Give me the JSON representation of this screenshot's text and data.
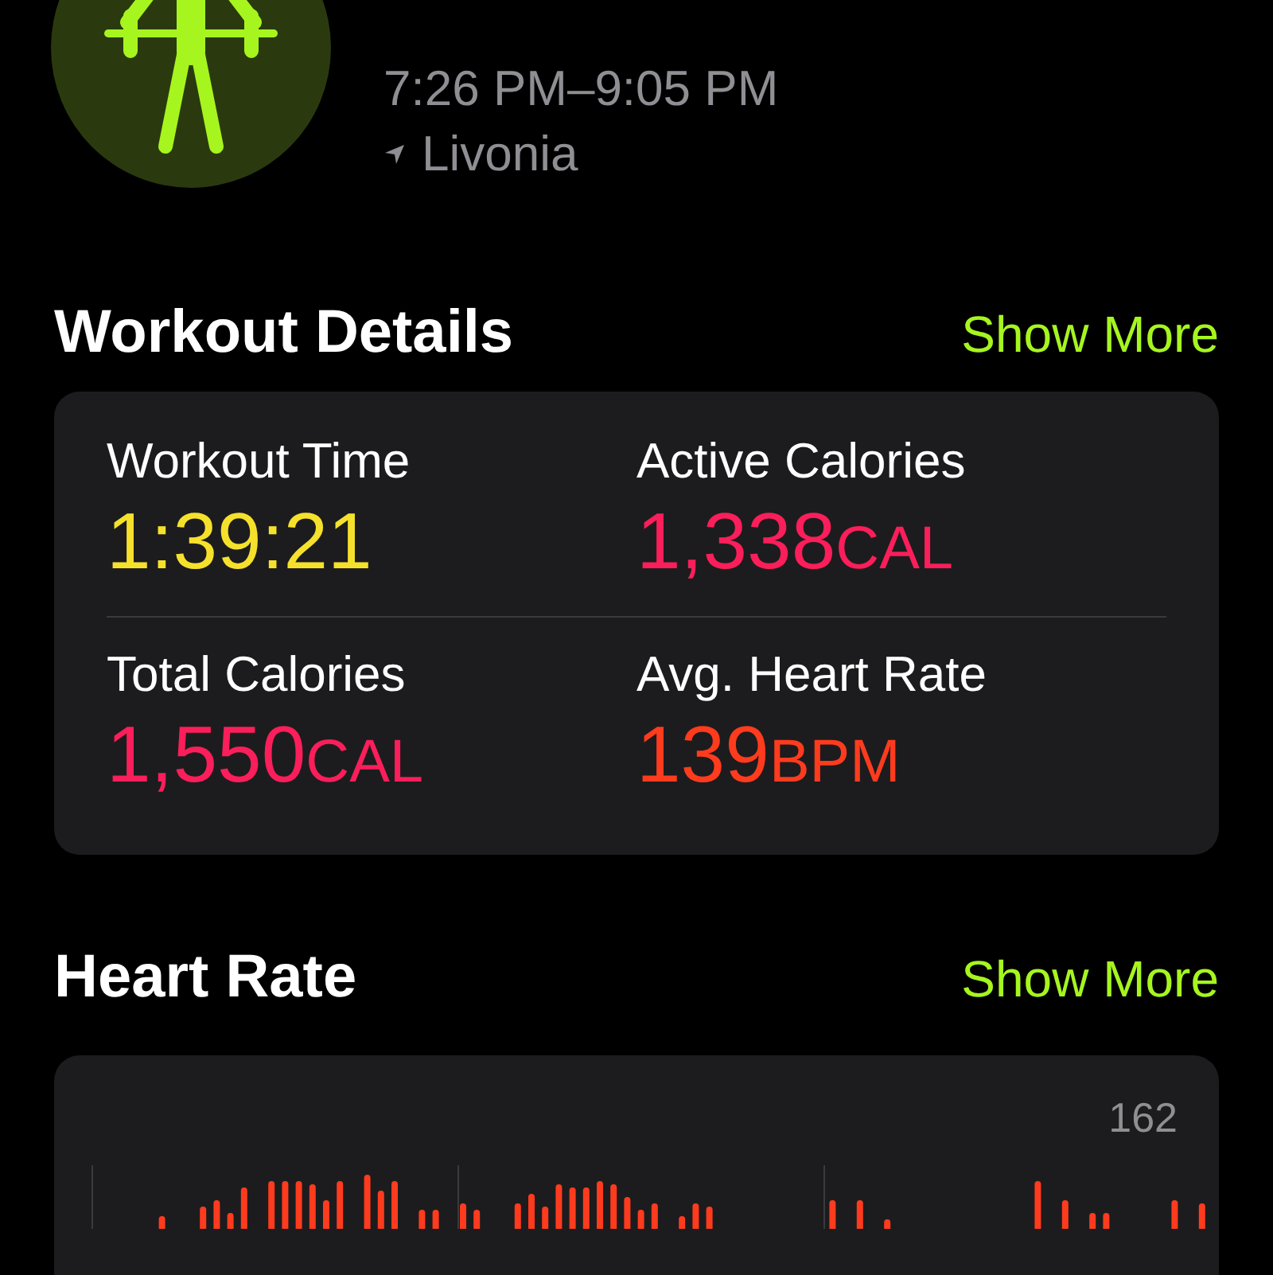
{
  "workout": {
    "time_range": "7:26 PM–9:05 PM",
    "location": "Livonia"
  },
  "workout_details": {
    "title": "Workout Details",
    "action": "Show More",
    "metrics": [
      {
        "label": "Workout Time",
        "value": "1:39:21",
        "color": "#f5e12c"
      },
      {
        "label": "Active Calories",
        "value": "1,338",
        "unit": "CAL",
        "color": "#fa1e5a"
      },
      {
        "label": "Total Calories",
        "value": "1,550",
        "unit": "CAL",
        "color": "#fa1e5a"
      },
      {
        "label": "Avg. Heart Rate",
        "value": "139",
        "unit": "BPM",
        "color": "#ff3b1e"
      }
    ]
  },
  "heart_rate": {
    "title": "Heart Rate",
    "action": "Show More",
    "max_label": "162"
  }
}
